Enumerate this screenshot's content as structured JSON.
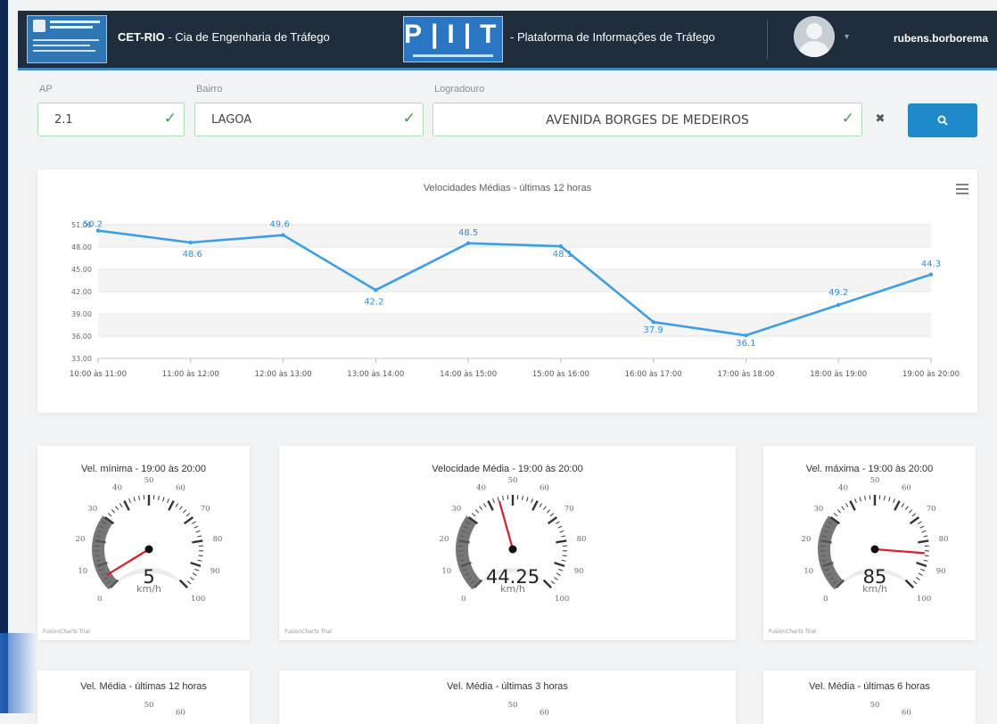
{
  "header": {
    "org_name": "CET-RIO",
    "org_full": " - Cia de Engenharia de Tráfego",
    "logo_letters": "P|I|T",
    "platform_name": "- Plataforma de Informações de Tráfego",
    "username": "rubens.borborema"
  },
  "filters": {
    "ap": {
      "label": "AP",
      "value": "2.1"
    },
    "bairro": {
      "label": "Bairro",
      "value": "LAGOA"
    },
    "logradouro": {
      "label": "Logradouro",
      "value": "AVENIDA BORGES DE MEDEIROS"
    },
    "clear_symbol": "✖",
    "check_symbol": "✓"
  },
  "icons": {
    "search": "search-icon",
    "clear": "close-icon",
    "menu": "hamburger-menu-icon",
    "avatar": "user-avatar",
    "check": "check-icon",
    "caret": "chevron-down-icon"
  },
  "colors": {
    "header_bg": "#1f2d3d",
    "accent": "#1f8ac9",
    "line": "#3d9ee8",
    "valid": "#36a24a",
    "needle": "#d91d2c"
  },
  "chart_data": {
    "type": "line",
    "title": "Velocidades Médias - últimas 12 horas",
    "categories": [
      "10:00 às 11:00",
      "11:00 às 12:00",
      "12:00 às 13:00",
      "13:00 às 14:00",
      "14:00 às 15:00",
      "15:00 às 16:00",
      "16:00 às 17:00",
      "17:00 às 18:00",
      "18:00 às 19:00",
      "19:00 às 20:00"
    ],
    "values": [
      50.2,
      48.6,
      49.6,
      42.2,
      48.5,
      48.1,
      37.9,
      36.1,
      40.2,
      44.3
    ],
    "value_labels": [
      "50.2",
      "48.6",
      "49.6",
      "42.2",
      "48.5",
      "48.1",
      "37.9",
      "36.1",
      "49.2",
      "44.3"
    ],
    "ytick_labels": [
      "51.00",
      "48.00",
      "45.00",
      "42.00",
      "39.00",
      "36.00",
      "33.00"
    ],
    "ylim": [
      33,
      51
    ],
    "grid": true
  },
  "gauges": [
    {
      "title": "Vel. mínima - 19:00 às 20:00",
      "value": 5,
      "display": "5",
      "unit": "km/h",
      "trial": "FusionCharts Trial"
    },
    {
      "title": "Velocidade Média - 19:00 às 20:00",
      "value": 44.25,
      "display": "44.25",
      "unit": "km/h",
      "trial": "FusionCharts Trial"
    },
    {
      "title": "Vel. máxima - 19:00 às 20:00",
      "value": 85,
      "display": "85",
      "unit": "km/h",
      "trial": "FusionCharts Trial"
    }
  ],
  "gauge_scale": {
    "min": 0,
    "max": 100,
    "labels": [
      "0",
      "10",
      "20",
      "30",
      "40",
      "50",
      "60",
      "70",
      "80",
      "90",
      "100"
    ]
  },
  "lower_titles": [
    "Vel. Média - últimas 12 horas",
    "Vel. Média - últimas 3 horas",
    "Vel. Média - últimas 6 horas"
  ]
}
